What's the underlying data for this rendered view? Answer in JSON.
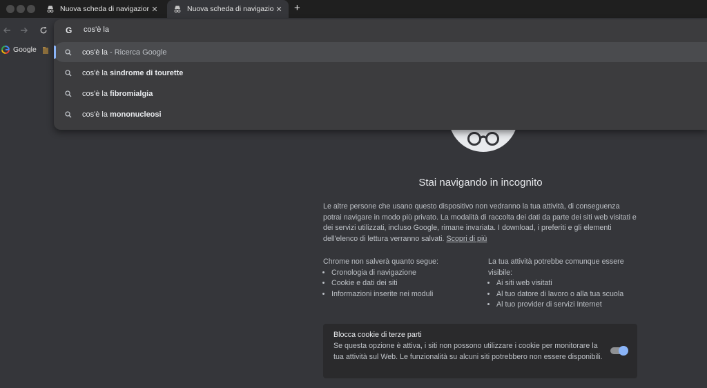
{
  "tabs": [
    {
      "title": "Nuova scheda di navigazione",
      "active": false
    },
    {
      "title": "Nuova scheda di navigazione",
      "active": true
    }
  ],
  "toolbar": {
    "back_icon": "arrow-left-icon",
    "forward_icon": "arrow-right-icon",
    "reload_icon": "reload-icon"
  },
  "bookmarks": {
    "google_label": "Google"
  },
  "omnibox": {
    "query": "cos'è la",
    "suggestions": [
      {
        "query": "cos'è la",
        "bold": "",
        "desc": " - Ricerca Google",
        "selected": true
      },
      {
        "query": "cos'è la ",
        "bold": "sindrome di tourette",
        "desc": "",
        "selected": false
      },
      {
        "query": "cos'è la ",
        "bold": "fibromialgia",
        "desc": "",
        "selected": false
      },
      {
        "query": "cos'è la ",
        "bold": "mononucleosi",
        "desc": "",
        "selected": false
      }
    ]
  },
  "incognito": {
    "headline": "Stai navigando in incognito",
    "intro": "Le altre persone che usano questo dispositivo non vedranno la tua attività, di conseguenza potrai navigare in modo più privato. La modalità di raccolta dei dati da parte dei siti web visitati e dei servizi utilizzati, incluso Google, rimane invariata. I download, i preferiti e gli elementi dell'elenco di lettura verranno salvati.",
    "learn_more": "Scopri di più",
    "left_title": "Chrome non salverà quanto segue:",
    "left_items": [
      "Cronologia di navigazione",
      "Cookie e dati dei siti",
      "Informazioni inserite nei moduli"
    ],
    "right_title": "La tua attività potrebbe comunque essere visibile:",
    "right_items": [
      "Ai siti web visitati",
      "Al tuo datore di lavoro o alla tua scuola",
      "Al tuo provider di servizi Internet"
    ],
    "cookie_title": "Blocca cookie di terze parti",
    "cookie_desc": "Se questa opzione è attiva, i siti non possono utilizzare i cookie per monitorare la tua attività sul Web. Le funzionalità su alcuni siti potrebbero non essere disponibili.",
    "cookie_toggle_on": true
  },
  "colors": {
    "accent": "#8ab4f8",
    "page_bg": "#35363a",
    "tabstrip_bg": "#1f1f1f"
  }
}
